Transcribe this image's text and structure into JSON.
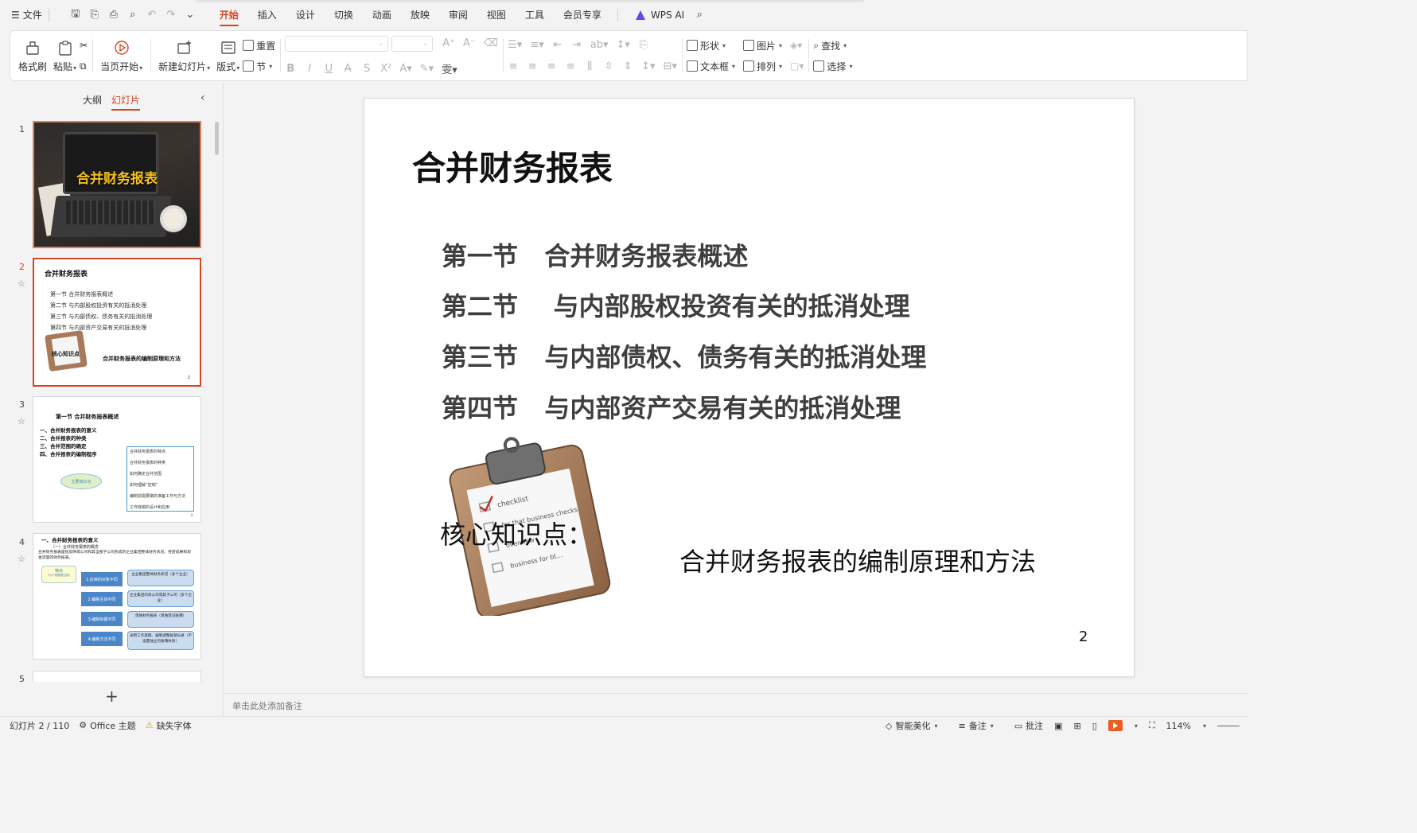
{
  "menubar": {
    "file_label": "文件",
    "tabs": [
      "开始",
      "插入",
      "设计",
      "切换",
      "动画",
      "放映",
      "审阅",
      "视图",
      "工具",
      "会员专享"
    ],
    "active_tab": "开始",
    "wps_ai_label": "WPS AI"
  },
  "ribbon": {
    "format_painter": "格式刷",
    "paste": "粘贴",
    "from_start": "当页开始",
    "new_slide": "新建幻灯片",
    "layout": "版式",
    "reset": "重置",
    "section": "节",
    "shape": "形状",
    "picture": "图片",
    "textbox": "文本框",
    "arrange": "排列",
    "find": "查找",
    "select": "选择"
  },
  "left_panel": {
    "tab_outline": "大纲",
    "tab_slides": "幻灯片",
    "active_tab": "幻灯片",
    "slide_numbers": [
      "1",
      "2",
      "3",
      "4",
      "5"
    ],
    "thumb1": {
      "title": "合并财务报表"
    },
    "thumb2": {
      "title": "合并财务报表",
      "items": [
        "第一节   合并财务报表概述",
        "第二节    与内部股权投资有关的抵消处理",
        "第三节   与内部债权、债务有关的抵消处理",
        "第四节   与内部资产交易有关的抵消处理"
      ],
      "core": "核心知识点",
      "method": "合并财务报表的编制原理和方法",
      "page": "2"
    },
    "thumb3": {
      "title": "第一节   合并财务报表概述",
      "items": [
        "一、合并财务报表的意义",
        "二、合并报表的种类",
        "三、合并范围的确定",
        "四、合并报表的编制程序"
      ],
      "box_items": [
        "合并财务报表的特点",
        "合并财务报表的种类",
        "如何确定合并范围",
        "如何理解“控制”",
        "编制前需要做的准备工作与方法",
        "工作底稿的设计和应用"
      ],
      "oval": "主要知识点",
      "page": "3"
    },
    "thumb4": {
      "title": "一、合并财务报表的意义",
      "subtitle": "（一）合并财务报表的概念",
      "text": "合并财务报表是指反映母公司和其全部子公司形成的企业集团整体财务状况、经营成果和现金流量的财务报表。",
      "note": "特点",
      "note_sub": "（与个别报表比较）",
      "blue_boxes": [
        "1.反映的对象不同",
        "2.编制主体不同",
        "3.编制依据不同",
        "4.编制方法不同"
      ],
      "pale_boxes": [
        "企业集团整体财务状况（多个企业）",
        "企业集团的母公司或其子公司（多个企业）",
        "单独财务报表（单独登记账簿）",
        "采用工作底稿、编制调整抵销分录（不设置独立的账簿体系）"
      ]
    }
  },
  "slide": {
    "title": "合并财务报表",
    "items": [
      "第一节   合并财务报表概述",
      "第二节    与内部股权投资有关的抵消处理",
      "第三节   与内部债权、债务有关的抵消处理",
      "第四节   与内部资产交易有关的抵消处理"
    ],
    "core_label": "核心知识点：",
    "method_text": "合并财务报表的编制原理和方法",
    "page_number": "2",
    "clipboard_lines": [
      "checklist",
      "for that business checks",
      "overview",
      "business for bt..."
    ]
  },
  "notes": {
    "placeholder": "单击此处添加备注"
  },
  "statusbar": {
    "slide_counter": "幻灯片 2 / 110",
    "theme": "Office 主题",
    "missing_font": "缺失字体",
    "smart_beautify": "智能美化",
    "notes": "备注",
    "comments": "批注",
    "zoom": "114%"
  },
  "colors": {
    "accent": "#d24726",
    "slide_text": "#3f3f3f",
    "thumb_title_gold": "#f6c31c"
  }
}
